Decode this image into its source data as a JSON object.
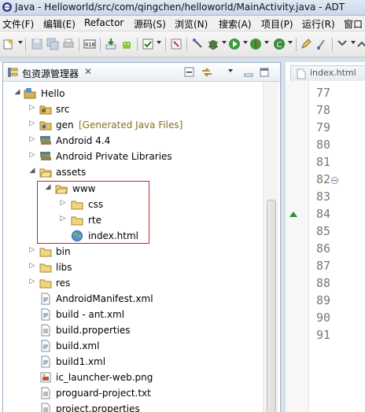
{
  "window": {
    "title": "Java - Helloworld/src/com/qingchen/helloworld/MainActivity.java - ADT"
  },
  "menu": [
    "文件(F)",
    "编辑(E)",
    "Refactor",
    "源码(S)",
    "浏览(N)",
    "搜索(A)",
    "项目(P)",
    "运行(R)",
    "窗口"
  ],
  "explorer": {
    "title": "包资源管理器",
    "close": "✕",
    "tree": [
      {
        "label": "Hello",
        "expanded": true
      },
      {
        "label": "src"
      },
      {
        "label": "gen",
        "extra": "[Generated Java Files]"
      },
      {
        "label": "Android 4.4"
      },
      {
        "label": "Android Private Libraries"
      },
      {
        "label": "assets",
        "expanded": true
      },
      {
        "label": "www",
        "expanded": true
      },
      {
        "label": "css"
      },
      {
        "label": "rte"
      },
      {
        "label": "index.html"
      },
      {
        "label": "bin"
      },
      {
        "label": "libs"
      },
      {
        "label": "res"
      },
      {
        "label": "AndroidManifest.xml"
      },
      {
        "label": "build - ant.xml"
      },
      {
        "label": "build.properties"
      },
      {
        "label": "build.xml"
      },
      {
        "label": "build1.xml"
      },
      {
        "label": "ic_launcher-web.png"
      },
      {
        "label": "proguard-project.txt"
      },
      {
        "label": "project.properties"
      }
    ]
  },
  "editor": {
    "tab_label": "index.html",
    "line_numbers": [
      "77",
      "78",
      "79",
      "80",
      "81",
      "82",
      "83",
      "84",
      "85",
      "86",
      "87",
      "88",
      "89",
      "90",
      "91"
    ]
  },
  "colors": {
    "highlight": "#c8262a",
    "generated_text": "#8b6d1b",
    "line_number": "#787878"
  }
}
